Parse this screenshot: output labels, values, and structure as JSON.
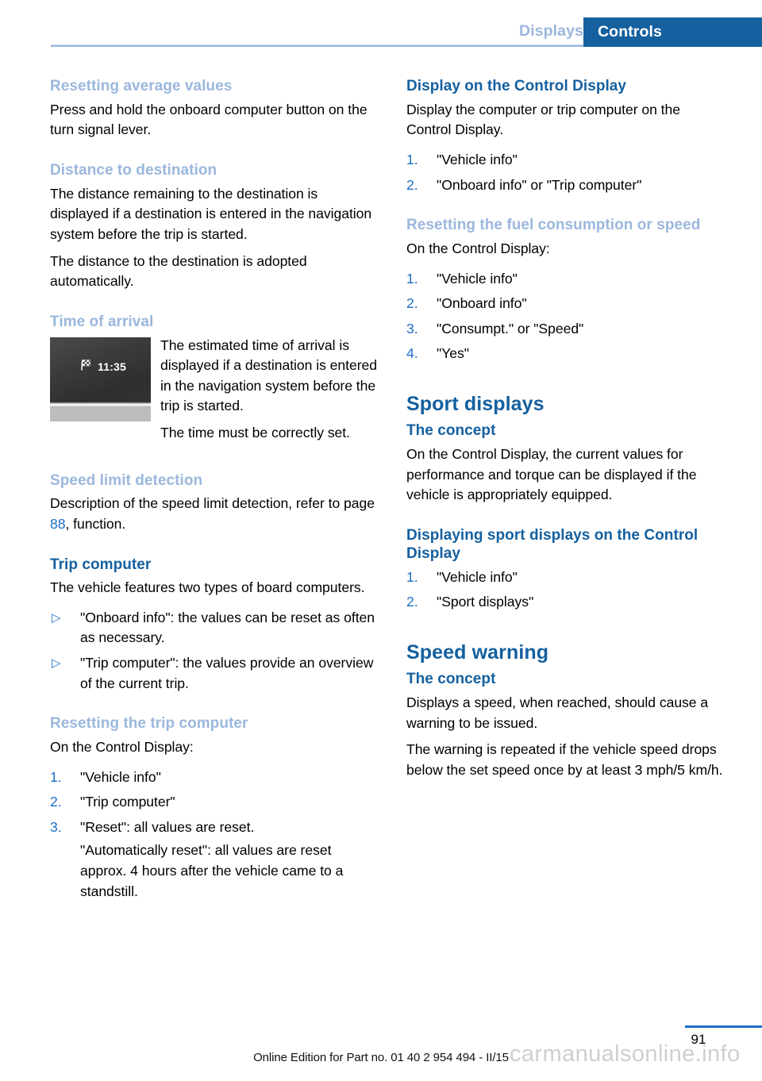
{
  "header": {
    "tab_inactive": "Displays",
    "tab_active": "Controls",
    "accent_blue": "#15609F",
    "light_blue": "#9BB7DC"
  },
  "left_column": {
    "s1_heading": "Resetting average values",
    "s1_para": "Press and hold the onboard computer button on the turn signal lever.",
    "s2_heading": "Distance to destination",
    "s2_para1": "The distance remaining to the destination is displayed if a destination is entered in the navigation system before the trip is started.",
    "s2_para2": "The distance to the destination is adopted automatically.",
    "s3_heading": "Time of arrival",
    "figure": {
      "icon": "checkered-flag-icon",
      "time_value": "11:35"
    },
    "s3_para1": "The estimated time of arrival is displayed if a destination is entered in the navigation system before the trip is started.",
    "s3_para2": "The time must be correctly set.",
    "s4_heading": "Speed limit detection",
    "s4_para_before": "Description of the speed limit detection, refer to page ",
    "s4_page_ref": "88",
    "s4_para_after": ", function.",
    "s5_heading": "Trip computer",
    "s5_para": "The vehicle features two types of board computers.",
    "s5_bullets": [
      {
        "marker": "▷",
        "text": "\"Onboard info\": the values can be reset as often as necessary."
      },
      {
        "marker": "▷",
        "text": "\"Trip computer\": the values provide an overview of the current trip."
      }
    ],
    "s6_heading": "Resetting the trip computer",
    "s6_para": "On the Control Display:",
    "s6_steps": [
      {
        "marker": "1.",
        "text": "\"Vehicle info\""
      },
      {
        "marker": "2.",
        "text": "\"Trip computer\""
      },
      {
        "marker": "3.",
        "text": "\"Reset\": all values are reset.",
        "sub": "\"Automatically reset\": all values are reset approx. 4 hours after the vehicle came to a standstill."
      }
    ]
  },
  "right_column": {
    "s1_heading": "Display on the Control Display",
    "s1_para": "Display the computer or trip computer on the Control Display.",
    "s1_steps": [
      {
        "marker": "1.",
        "text": "\"Vehicle info\""
      },
      {
        "marker": "2.",
        "text": "\"Onboard info\" or \"Trip computer\""
      }
    ],
    "s2_heading": "Resetting the fuel consumption or speed",
    "s2_para": "On the Control Display:",
    "s2_steps": [
      {
        "marker": "1.",
        "text": "\"Vehicle info\""
      },
      {
        "marker": "2.",
        "text": "\"Onboard info\""
      },
      {
        "marker": "3.",
        "text": "\"Consumpt.\" or \"Speed\""
      },
      {
        "marker": "4.",
        "text": "\"Yes\""
      }
    ],
    "s3_title": "Sport displays",
    "s3_heading": "The concept",
    "s3_para": "On the Control Display, the current values for performance and torque can be displayed if the vehicle is appropriately equipped.",
    "s4_heading": "Displaying sport displays on the Control Display",
    "s4_steps": [
      {
        "marker": "1.",
        "text": "\"Vehicle info\""
      },
      {
        "marker": "2.",
        "text": "\"Sport displays\""
      }
    ],
    "s5_title": "Speed warning",
    "s5_heading": "The concept",
    "s5_para1": "Displays a speed, when reached, should cause a warning to be issued.",
    "s5_para2": "The warning is repeated if the vehicle speed drops below the set speed once by at least 3 mph/5 km/h."
  },
  "footer": {
    "page_number": "91",
    "edition_text": "Online Edition for Part no. 01 40 2 954 494 - II/15",
    "watermark": "carmanualsonline.info"
  }
}
